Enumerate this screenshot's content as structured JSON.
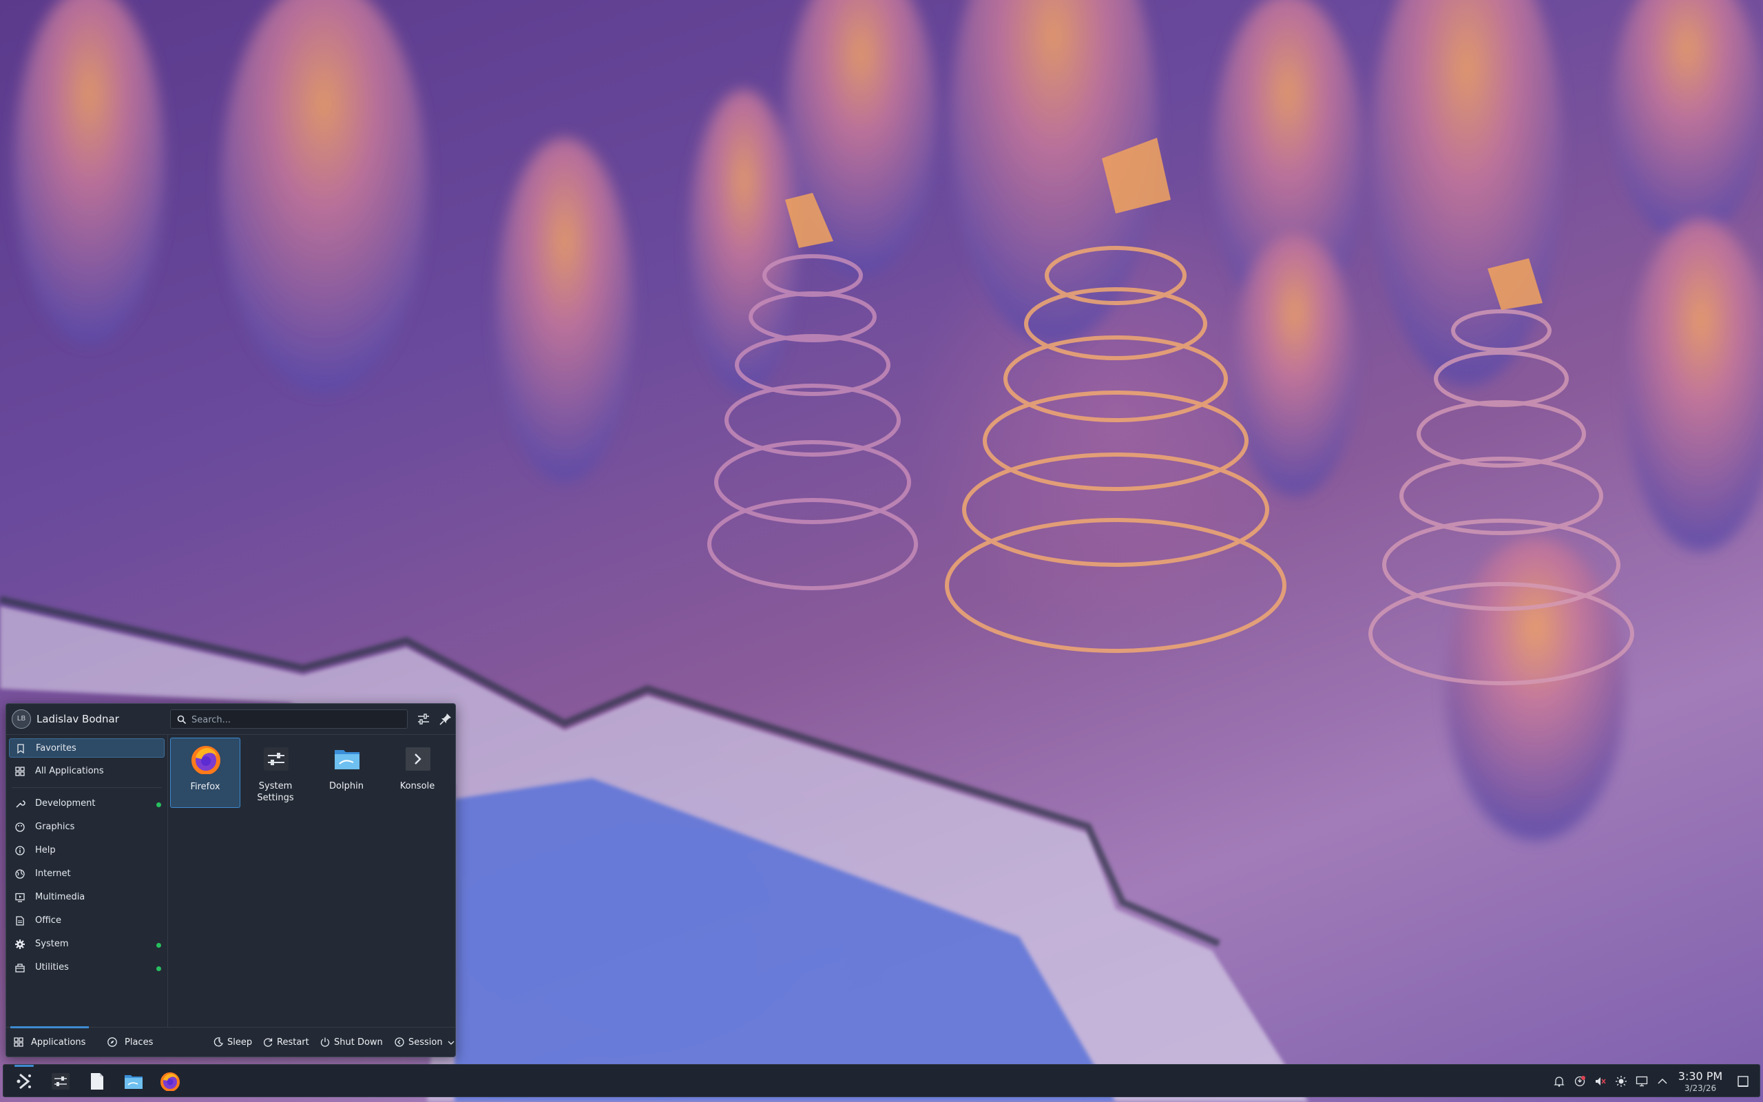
{
  "launcher": {
    "user": {
      "initials": "LB",
      "name": "Ladislav Bodnar"
    },
    "search": {
      "placeholder": "Search..."
    },
    "categories": [
      {
        "label": "Favorites",
        "icon": "bookmark-icon",
        "active": true,
        "new": false
      },
      {
        "label": "All Applications",
        "icon": "grid-icon",
        "active": false,
        "new": false
      },
      {
        "label": "Development",
        "icon": "wrench-icon",
        "active": false,
        "new": true
      },
      {
        "label": "Graphics",
        "icon": "palette-icon",
        "active": false,
        "new": false
      },
      {
        "label": "Help",
        "icon": "info-icon",
        "active": false,
        "new": false
      },
      {
        "label": "Internet",
        "icon": "globe-icon",
        "active": false,
        "new": false
      },
      {
        "label": "Multimedia",
        "icon": "monitor-play-icon",
        "active": false,
        "new": false
      },
      {
        "label": "Office",
        "icon": "document-icon",
        "active": false,
        "new": false
      },
      {
        "label": "System",
        "icon": "gear-icon",
        "active": false,
        "new": true
      },
      {
        "label": "Utilities",
        "icon": "toolbox-icon",
        "active": false,
        "new": true
      }
    ],
    "apps": [
      {
        "label": "Firefox",
        "icon": "firefox-icon",
        "active": true
      },
      {
        "label": "System Settings",
        "icon": "system-settings-icon",
        "active": false
      },
      {
        "label": "Dolphin",
        "icon": "folder-icon",
        "active": false
      },
      {
        "label": "Konsole",
        "icon": "terminal-icon",
        "active": false
      }
    ],
    "footer": {
      "tabs": [
        "Applications",
        "Places"
      ],
      "power": [
        "Sleep",
        "Restart",
        "Shut Down",
        "Session"
      ]
    }
  },
  "taskbar": {
    "pinned": [
      "launcher-icon",
      "system-settings-icon",
      "text-editor-icon",
      "dolphin-icon",
      "firefox-icon"
    ],
    "tray": [
      "notifications-icon",
      "update-icon",
      "volume-muted-icon",
      "brightness-icon",
      "display-icon",
      "expand-tray-icon"
    ],
    "clock": {
      "time": "3:30 PM",
      "date": "3/23/26"
    }
  },
  "colors": {
    "accent": "#3d8bd0",
    "panel_bg": "#232a35",
    "selection_bg": "#2d4a66",
    "new_badge": "#27c05f"
  }
}
